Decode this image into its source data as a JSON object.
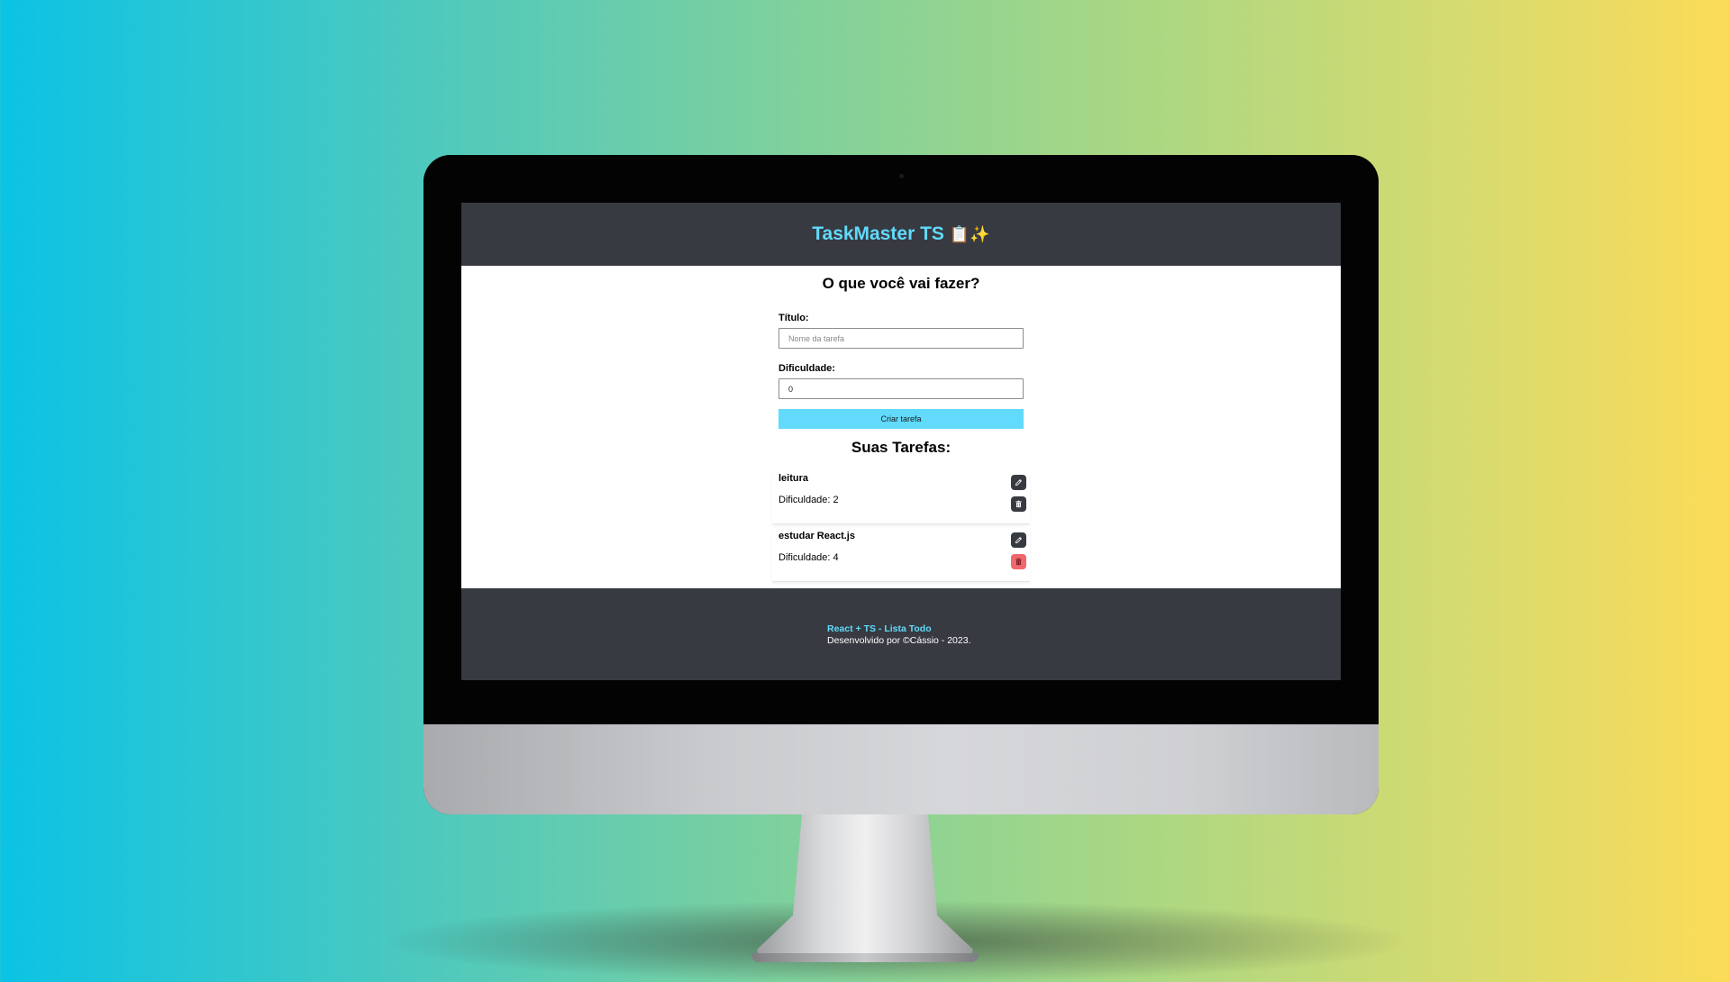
{
  "app": {
    "title": "TaskMaster TS",
    "title_emoji": "📋✨"
  },
  "form": {
    "heading": "O que você vai fazer?",
    "title_label": "Título:",
    "title_placeholder": "Nome da tarefa",
    "title_value": "",
    "difficulty_label": "Dificuldade:",
    "difficulty_value": "0",
    "submit_label": "Criar tarefa"
  },
  "tasks_section": {
    "heading": "Suas Tarefas:",
    "tasks": [
      {
        "title": "leitura",
        "difficulty": "Dificuldade: 2",
        "edit_icon": "pencil-icon",
        "delete_icon": "trash-icon",
        "delete_state": "normal"
      },
      {
        "title": "estudar React.js",
        "difficulty": "Dificuldade: 4",
        "edit_icon": "pencil-icon",
        "delete_icon": "trash-icon",
        "delete_state": "hover"
      }
    ]
  },
  "footer": {
    "link_text": "React + TS - Lista Todo",
    "credit": "Desenvolvido por ©Cássio - 2023."
  },
  "colors": {
    "header_bg": "#383a41",
    "accent": "#61dafb",
    "danger": "#f0686c",
    "background_gradient": [
      "#0bc3e4",
      "#7dd09d",
      "#fcdb58"
    ]
  }
}
